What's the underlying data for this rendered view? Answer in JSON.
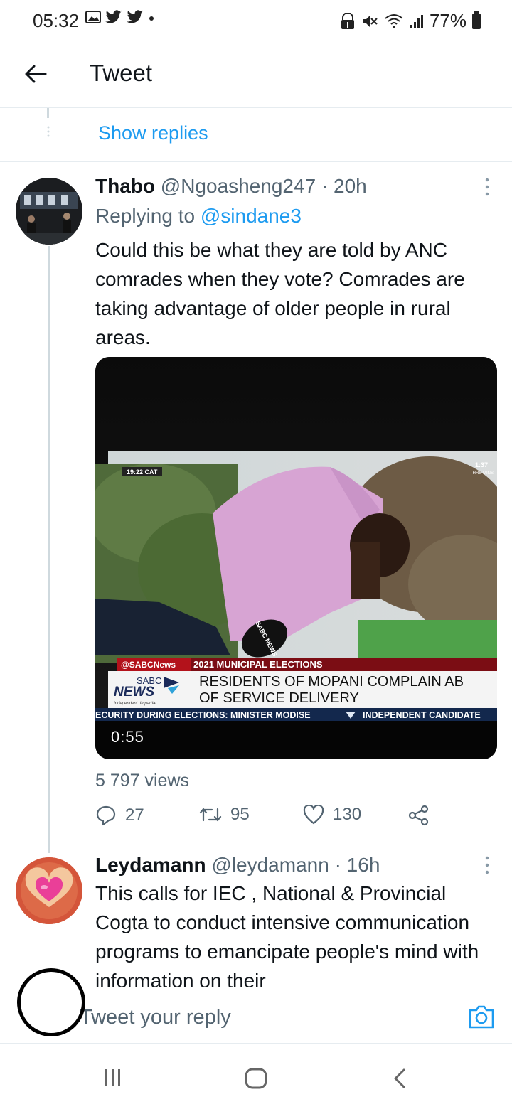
{
  "status_bar": {
    "time": "05:32",
    "battery": "77%"
  },
  "header": {
    "title": "Tweet"
  },
  "thread": {
    "show_replies": "Show replies"
  },
  "tweet1": {
    "name": "Thabo",
    "handle": "@Ngoasheng247",
    "time": "· 20h",
    "replying_prefix": "Replying to",
    "replying_to": "@sindane3",
    "text": "Could this be what they are told by ANC comrades when they vote? Comrades are taking advantage of older people in rural areas.",
    "video": {
      "duration": "0:55",
      "overlay_time": "19:22 CAT",
      "corner_top": "1:37",
      "corner_bottom": "HRS MINS",
      "channel_handle": "@SABCNews",
      "category": "2021 MUNICIPAL ELECTIONS",
      "headline_line1": "RESIDENTS OF MOPANI COMPLAIN AB",
      "headline_line2": "OF SERVICE DELIVERY",
      "logo_top": "SABC",
      "logo_bottom": "NEWS",
      "logo_tagline": "Independent. Impartial.",
      "ticker_left": "ECURITY DURING ELECTIONS: MINISTER MODISE",
      "ticker_right": "INDEPENDENT CANDIDATE",
      "mic_label": "SABC NEWS"
    },
    "views": "5 797 views",
    "replies": "27",
    "retweets": "95",
    "likes": "130"
  },
  "tweet2": {
    "name": "Leydamann",
    "handle": "@leydamann",
    "time": "· 16h",
    "text": "This calls for IEC , National & Provincial Cogta to conduct intensive communication programs to emancipate people's mind with information on their"
  },
  "composer": {
    "placeholder": "Tweet your reply"
  },
  "colors": {
    "accent": "#1d9bf0",
    "secondary_text": "#536471",
    "divider": "#e6ecf0"
  }
}
